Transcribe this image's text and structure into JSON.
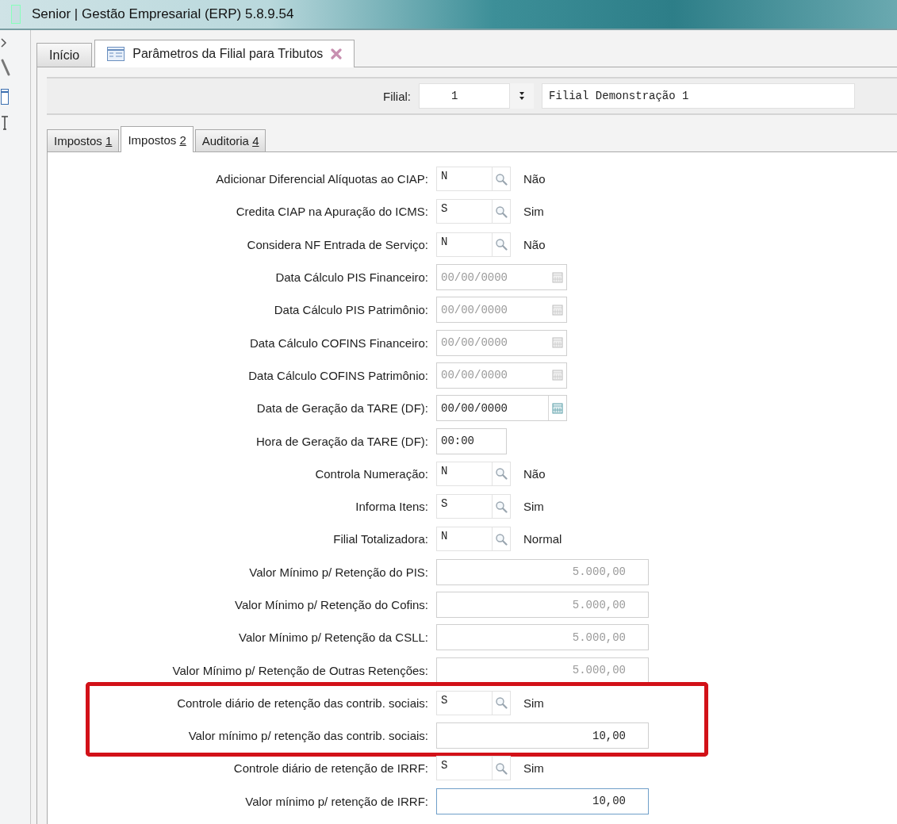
{
  "window": {
    "title": "Senior | Gestão Empresarial (ERP) 5.8.9.54"
  },
  "tabs": [
    {
      "label": "Início",
      "selected": false,
      "closable": false
    },
    {
      "label": "Parâmetros da Filial para Tributos",
      "selected": true,
      "closable": true
    }
  ],
  "filial": {
    "label": "Filial:",
    "code": "1",
    "name": "Filial Demonstração 1"
  },
  "inner_tabs": [
    {
      "label": "Impostos ",
      "shortcut": "1",
      "selected": false
    },
    {
      "label": "Impostos ",
      "shortcut": "2",
      "selected": true
    },
    {
      "label": "Auditoria ",
      "shortcut": "4",
      "selected": false
    }
  ],
  "fields": [
    {
      "kind": "lookup",
      "label": "Adicionar Diferencial Alíquotas ao CIAP:",
      "value": "N",
      "description": "Não",
      "highlighted": false
    },
    {
      "kind": "lookup",
      "label": "Credita CIAP na Apuração do ICMS:",
      "value": "S",
      "description": "Sim",
      "highlighted": false
    },
    {
      "kind": "lookup",
      "label": "Considera NF Entrada de Serviço:",
      "value": "N",
      "description": "Não",
      "highlighted": false
    },
    {
      "kind": "date",
      "label": "Data Cálculo PIS Financeiro:",
      "value": "00/00/0000",
      "disabled": true,
      "highlighted": false
    },
    {
      "kind": "date",
      "label": "Data Cálculo PIS Patrimônio:",
      "value": "00/00/0000",
      "disabled": true,
      "highlighted": false
    },
    {
      "kind": "date",
      "label": "Data Cálculo COFINS Financeiro:",
      "value": "00/00/0000",
      "disabled": true,
      "highlighted": false
    },
    {
      "kind": "date",
      "label": "Data Cálculo COFINS Patrimônio:",
      "value": "00/00/0000",
      "disabled": true,
      "highlighted": false
    },
    {
      "kind": "date",
      "label": "Data de Geração da TARE (DF):",
      "value": "00/00/0000",
      "disabled": false,
      "highlighted": false
    },
    {
      "kind": "time",
      "label": "Hora de Geração da TARE (DF):",
      "value": "00:00",
      "highlighted": false
    },
    {
      "kind": "lookup",
      "label": "Controla Numeração:",
      "value": "N",
      "description": "Não",
      "highlighted": false
    },
    {
      "kind": "lookup",
      "label": "Informa Itens:",
      "value": "S",
      "description": "Sim",
      "highlighted": false
    },
    {
      "kind": "lookup",
      "label": "Filial Totalizadora:",
      "value": "N",
      "description": "Normal",
      "highlighted": false
    },
    {
      "kind": "amount",
      "label": "Valor Mínimo p/ Retenção do PIS:",
      "value": "5.000,00",
      "disabled": true,
      "focused": false,
      "highlighted": false
    },
    {
      "kind": "amount",
      "label": "Valor Mínimo p/ Retenção do Cofins:",
      "value": "5.000,00",
      "disabled": true,
      "focused": false,
      "highlighted": false
    },
    {
      "kind": "amount",
      "label": "Valor Mínimo p/ Retenção da CSLL:",
      "value": "5.000,00",
      "disabled": true,
      "focused": false,
      "highlighted": false
    },
    {
      "kind": "amount",
      "label": "Valor Mínimo p/ Retenção de Outras Retenções:",
      "value": "5.000,00",
      "disabled": true,
      "focused": false,
      "highlighted": false
    },
    {
      "kind": "lookup",
      "label": "Controle diário de retenção das contrib. sociais:",
      "value": "S",
      "description": "Sim",
      "highlighted": true
    },
    {
      "kind": "amount",
      "label": "Valor mínimo p/ retenção das contrib. sociais:",
      "value": "10,00",
      "disabled": false,
      "focused": false,
      "highlighted": true
    },
    {
      "kind": "lookup",
      "label": "Controle diário de retenção de IRRF:",
      "value": "S",
      "description": "Sim",
      "highlighted": false
    },
    {
      "kind": "amount",
      "label": "Valor mínimo p/ retenção de IRRF:",
      "value": "10,00",
      "disabled": false,
      "focused": true,
      "highlighted": false
    }
  ]
}
